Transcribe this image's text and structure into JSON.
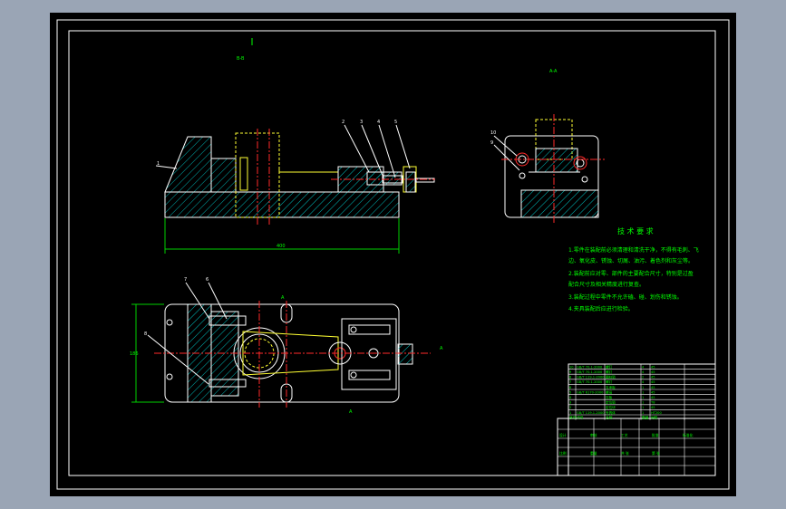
{
  "drawing": {
    "background": "#000000",
    "viewport_background": "#9aa5b5",
    "line_colors": {
      "frame": "#ffffff",
      "outline": "#ffffff",
      "center": "#ff2a2a",
      "hidden": "#ffff33",
      "hatch": "#00b8b8",
      "dimension": "#00d000",
      "text": "#00ff00",
      "leader": "#ffffff",
      "section": "#00ff00"
    },
    "view_labels": {
      "section_a": "A-A",
      "front_mark": "B-B",
      "top_mark": "A",
      "side_mark": "A",
      "bottom_mark": "A",
      "plan_mark": "A"
    },
    "part_numbers": [
      "1",
      "2",
      "3",
      "4",
      "5",
      "6",
      "7",
      "8",
      "9",
      "10"
    ],
    "dimensions": {
      "overall_length": "400",
      "overall_width": "186"
    },
    "technical_requirements": {
      "title": "技 术 要 求",
      "lines": [
        "1.零件在装配前必须清理和清洗干净，不得有毛刺、飞",
        "边、氧化皮、锈蚀、切屑、油污、着色剂和灰尘等。",
        "2.装配前应对零、部件的主要配合尺寸，特别是过盈",
        "配合尺寸及相关精度进行复查。",
        "3.装配过程中零件不允许磕、碰、划伤和锈蚀。",
        "4.夹具装配后应进行检验。"
      ]
    },
    "title_block": {
      "rows": [
        [
          "10",
          "GB/T 70.1-2000",
          "螺钉",
          "4",
          "45"
        ],
        [
          "9",
          "GB/T 70.1-2000",
          "螺钉",
          "4",
          "45"
        ],
        [
          "8",
          "GB/T 119.1-2000",
          "圆柱销",
          "2",
          "45"
        ],
        [
          "7",
          "GB/T 70.1-2000",
          "螺钉",
          "4",
          "45"
        ],
        [
          "6",
          "",
          "支承板",
          "1",
          "45"
        ],
        [
          "5",
          "GB/T 6170-2000",
          "螺母",
          "1",
          "45"
        ],
        [
          "4",
          "",
          "压板",
          "1",
          "45"
        ],
        [
          "3",
          "",
          "定位销",
          "1",
          "T8"
        ],
        [
          "2",
          "",
          "定位块",
          "1",
          "45"
        ],
        [
          "1",
          "GB/T 119.1-2000",
          "夹具体",
          "1",
          "HT200"
        ]
      ],
      "header": [
        "序号",
        "代号",
        "名称",
        "数量",
        "材料"
      ],
      "labels": [
        "设计",
        "审核",
        "工艺",
        "批准",
        "标准化",
        "比例",
        "重量",
        "共 张",
        "第 张"
      ]
    }
  }
}
